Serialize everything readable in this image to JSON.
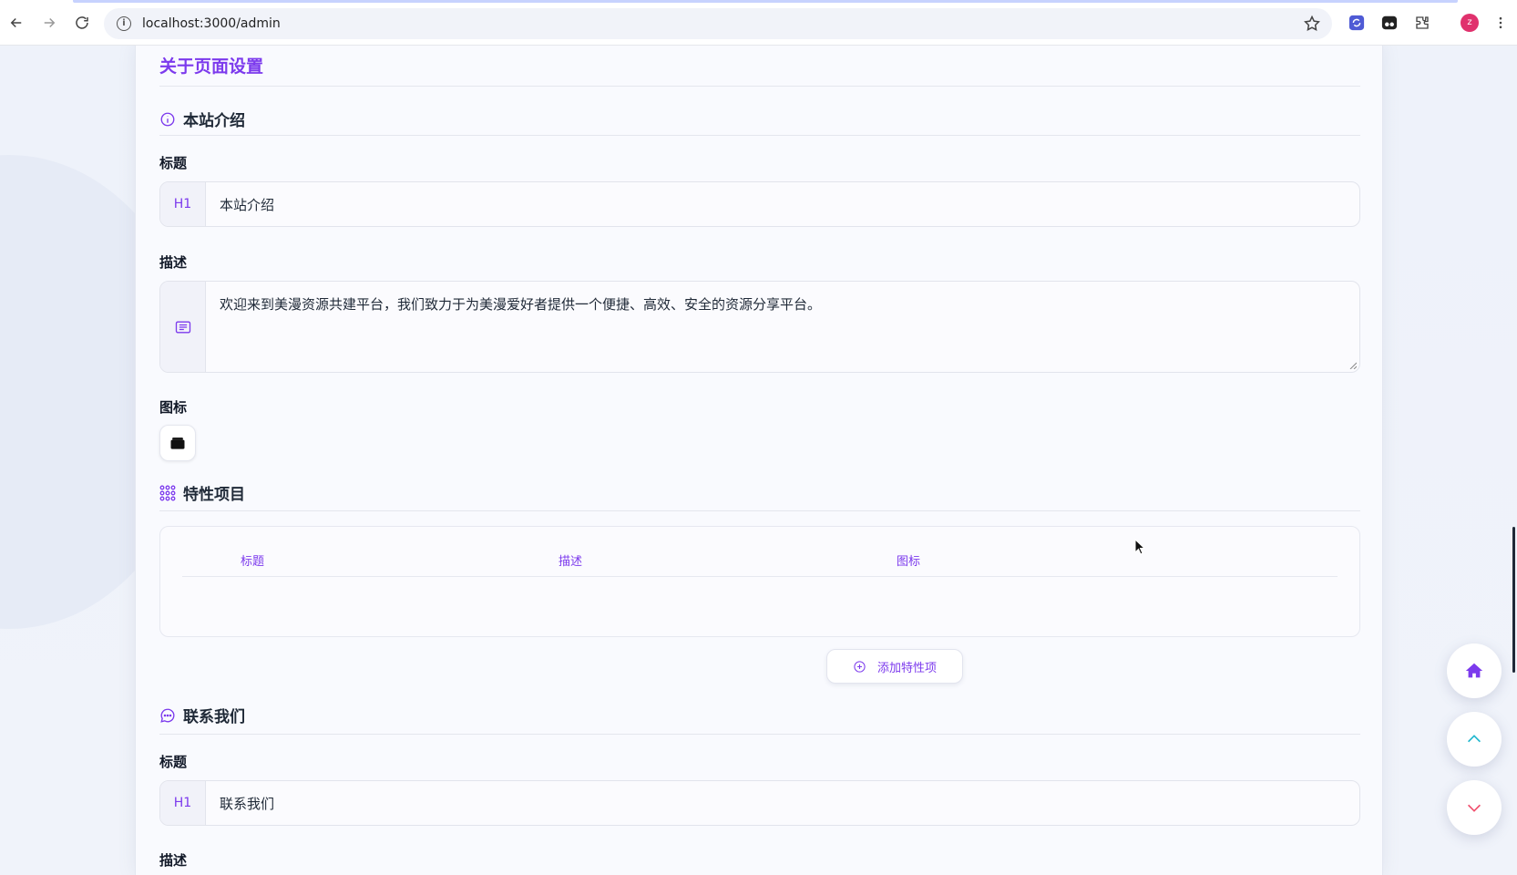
{
  "browser": {
    "url": "localhost:3000/admin",
    "avatar_letter": "z"
  },
  "page": {
    "title": "关于页面设置",
    "intro_section": {
      "heading": "本站介绍",
      "title_label": "标题",
      "title_addon": "H1",
      "title_value": "本站介绍",
      "desc_label": "描述",
      "desc_value": "欢迎来到美漫资源共建平台，我们致力于为美漫爱好者提供一个便捷、高效、安全的资源分享平台。",
      "icon_label": "图标"
    },
    "features_section": {
      "heading": "特性项目",
      "columns": [
        "标题",
        "描述",
        "图标"
      ],
      "add_button": "添加特性项"
    },
    "contact_section": {
      "heading": "联系我们",
      "title_label": "标题",
      "title_addon": "H1",
      "title_value": "联系我们",
      "desc_label": "描述"
    }
  },
  "fabs": [
    "home-icon",
    "chevron-up-icon",
    "chevron-down-icon"
  ],
  "colors": {
    "accent": "#7c3aed",
    "up": "#22b8cf",
    "down": "#f0506e"
  }
}
